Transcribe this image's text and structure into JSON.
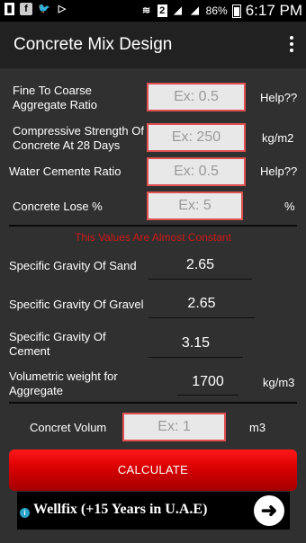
{
  "statusbar": {
    "signal_box": "2",
    "battery_pct": "86%",
    "time": "6:17 PM",
    "left_icons": [
      "sim-icon",
      "facebook-icon",
      "twitter-icon",
      "play-store-icon"
    ]
  },
  "appbar": {
    "title": "Concrete Mix Design"
  },
  "fields": {
    "ratio": {
      "label": "Fine To Coarse Aggregate Ratio",
      "placeholder": "Ex: 0.5",
      "value": "",
      "unit": "Help??"
    },
    "strength": {
      "label": "Compressive Strength Of Concrete At 28 Days",
      "placeholder": "Ex: 250",
      "value": "",
      "unit": "kg/m2"
    },
    "water": {
      "label": "Water Cemente Ratio",
      "placeholder": "Ex: 0.5",
      "value": "",
      "unit": "Help??"
    },
    "lose": {
      "label": "Concrete Lose %",
      "placeholder": "Ex: 5",
      "value": "",
      "unit": "%"
    }
  },
  "note": "This Values Are Almost Constant",
  "constants": {
    "sand": {
      "label": "Specific Gravity Of Sand",
      "value": "2.65"
    },
    "gravel": {
      "label": "Specific Gravity Of Gravel",
      "value": "2.65"
    },
    "cement": {
      "label": "Specific Gravity Of Cement",
      "value": "3.15"
    },
    "weight": {
      "label": "Volumetric weight for Aggregate",
      "value": "1700",
      "unit": "kg/m3"
    }
  },
  "volume": {
    "label": "Concret Volum",
    "placeholder": "Ex: 1",
    "value": "",
    "unit": "m3"
  },
  "calculate_label": "CALCULATE",
  "ad": {
    "text": "Wellfix (+15 Years in U.A.E)",
    "info": "i",
    "arrow": "➜"
  },
  "colors": {
    "accent_red": "#e05050",
    "note_red": "#d01818",
    "button_red": "#d80000",
    "background": "#303030",
    "appbar": "#212121"
  }
}
